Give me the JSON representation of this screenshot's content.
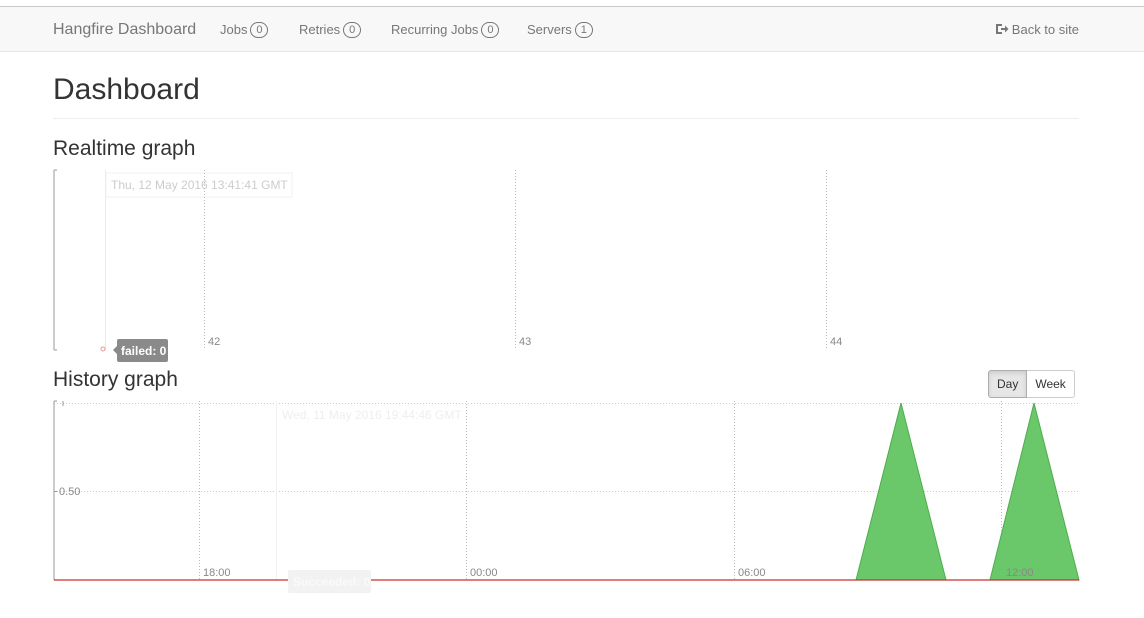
{
  "navbar": {
    "brand": "Hangfire Dashboard",
    "items": [
      {
        "label": "Jobs",
        "count": "0"
      },
      {
        "label": "Retries",
        "count": "0"
      },
      {
        "label": "Recurring Jobs",
        "count": "0"
      },
      {
        "label": "Servers",
        "count": "1"
      }
    ],
    "back_label": "Back to site",
    "back_icon": "sign-out-icon"
  },
  "page": {
    "title": "Dashboard"
  },
  "realtime": {
    "heading": "Realtime graph",
    "hover_time": "Thu, 12 May 2016 13:41:41 GMT",
    "hover_badge": "failed: 0",
    "x_ticks": [
      "42",
      "43",
      "44"
    ]
  },
  "history": {
    "heading": "History graph",
    "range_buttons": [
      "Day",
      "Week"
    ],
    "selected_range": "Day",
    "hover_time": "Wed, 11 May 2016 19:44:46 GMT",
    "hover_badge": "Succeeded: 0",
    "y_tick": "0.50",
    "x_ticks": [
      "18:00",
      "00:00",
      "06:00",
      "12:00"
    ]
  },
  "colors": {
    "succeeded": "#62c462",
    "failed": "#d9534f"
  }
}
